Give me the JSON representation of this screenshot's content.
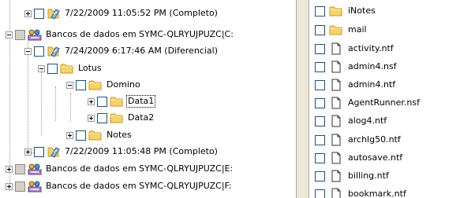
{
  "tree": {
    "items": [
      {
        "label": "7/22/2009 11:05:52 PM (Completo)",
        "icon": "backup-set-icon"
      },
      {
        "label": "Bancos de dados em SYMC-QLRYUJPUZC|C:",
        "icon": "database-server-icon"
      },
      {
        "label": "7/24/2009 6:17:46 AM (Diferencial)",
        "icon": "backup-set-icon"
      },
      {
        "label": "Lotus",
        "icon": "folder-icon"
      },
      {
        "label": "Domino",
        "icon": "folder-icon"
      },
      {
        "label": "Data1",
        "icon": "folder-icon"
      },
      {
        "label": "Data2",
        "icon": "folder-icon"
      },
      {
        "label": "Notes",
        "icon": "folder-icon"
      },
      {
        "label": "7/22/2009 11:05:48 PM (Completo)",
        "icon": "backup-set-icon"
      },
      {
        "label": "Bancos de dados em SYMC-QLRYUJPUZC|E:",
        "icon": "database-server-icon"
      },
      {
        "label": "Bancos de dados em SYMC-QLRYUJPUZC|F:",
        "icon": "database-server-icon"
      }
    ]
  },
  "files": {
    "items": [
      {
        "label": "iNotes",
        "icon": "folder-icon"
      },
      {
        "label": "mail",
        "icon": "folder-icon"
      },
      {
        "label": "activity.ntf",
        "icon": "file-icon"
      },
      {
        "label": "admin4.nsf",
        "icon": "file-icon"
      },
      {
        "label": "admin4.ntf",
        "icon": "file-icon"
      },
      {
        "label": "AgentRunner.nsf",
        "icon": "file-icon"
      },
      {
        "label": "alog4.ntf",
        "icon": "file-icon"
      },
      {
        "label": "archlg50.ntf",
        "icon": "file-icon"
      },
      {
        "label": "autosave.ntf",
        "icon": "file-icon"
      },
      {
        "label": "billing.ntf",
        "icon": "file-icon"
      },
      {
        "label": "bookmark.ntf",
        "icon": "file-icon"
      }
    ]
  },
  "colors": {
    "folder": "#f5d36a",
    "folder_edge": "#c99a1c",
    "checkbox_border": "#1c5180",
    "checkbox_grey": "#d4d0c8",
    "splitter": "#ece9d8"
  }
}
